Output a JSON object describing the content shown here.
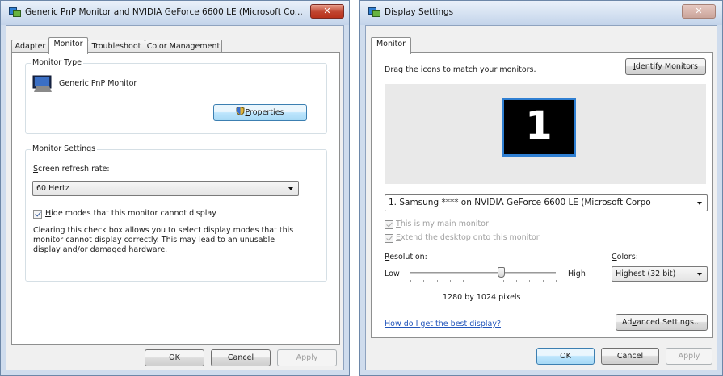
{
  "left_window": {
    "title": "Generic PnP Monitor and NVIDIA GeForce 6600 LE (Microsoft Co...",
    "close_glyph": "✕",
    "tabs": [
      "Adapter",
      "Monitor",
      "Troubleshoot",
      "Color Management"
    ],
    "monitor_type": {
      "label": "Monitor Type",
      "name": "Generic PnP Monitor",
      "properties_button": {
        "accel": "P",
        "rest": "roperties"
      }
    },
    "monitor_settings": {
      "label": "Monitor Settings",
      "refresh_label": {
        "accel": "S",
        "rest": "creen refresh rate:"
      },
      "refresh_value": "60 Hertz",
      "hide_modes": {
        "accel": "H",
        "rest": "ide modes that this monitor cannot display",
        "checked": true
      },
      "description": [
        "Clearing this check box allows you to select display modes that this",
        "monitor cannot display correctly. This may lead to an unusable",
        "display and/or damaged hardware."
      ]
    },
    "buttons": {
      "ok": "OK",
      "cancel": "Cancel",
      "apply": "Apply"
    }
  },
  "right_window": {
    "title": "Display Settings",
    "close_glyph": "✕",
    "tab": "Monitor",
    "instructions": "Drag the icons to match your monitors.",
    "identify_button": {
      "accel": "I",
      "rest": "dentify Monitors"
    },
    "monitor_number": "1",
    "monitor_select": "1. Samsung **** on NVIDIA GeForce 6600 LE (Microsoft Corpo",
    "main_monitor": {
      "accel": "T",
      "rest": "his is my main monitor",
      "checked": true,
      "enabled": false
    },
    "extend_desktop": {
      "accel": "E",
      "rest": "xtend the desktop onto this monitor",
      "checked": true,
      "enabled": false
    },
    "resolution": {
      "label": {
        "accel": "R",
        "rest": "esolution:"
      },
      "low": "Low",
      "high": "High",
      "value": "1280 by 1024 pixels",
      "slider_fraction": 0.62
    },
    "colors": {
      "label": {
        "accel": "C",
        "rest": "olors:"
      },
      "value": "Highest (32 bit)"
    },
    "help_link": "How do I get the best display?",
    "advanced_button": {
      "pre": "Ad",
      "accel": "v",
      "rest": "anced Settings..."
    },
    "buttons": {
      "ok": "OK",
      "cancel": "Cancel",
      "apply": "Apply"
    }
  }
}
